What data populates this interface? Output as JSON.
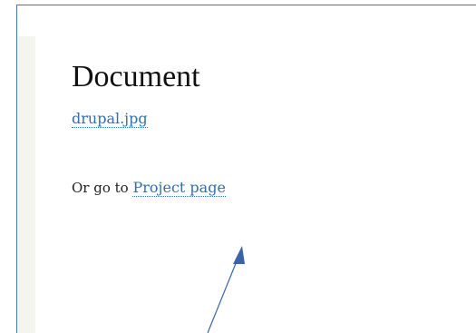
{
  "page": {
    "title": "Document",
    "file_link": "drupal.jpg",
    "goto_prefix": "Or go to ",
    "project_link": "Project page"
  },
  "annotation": {
    "arrow_color": "#3a63a8",
    "icon": "arrow-icon"
  }
}
